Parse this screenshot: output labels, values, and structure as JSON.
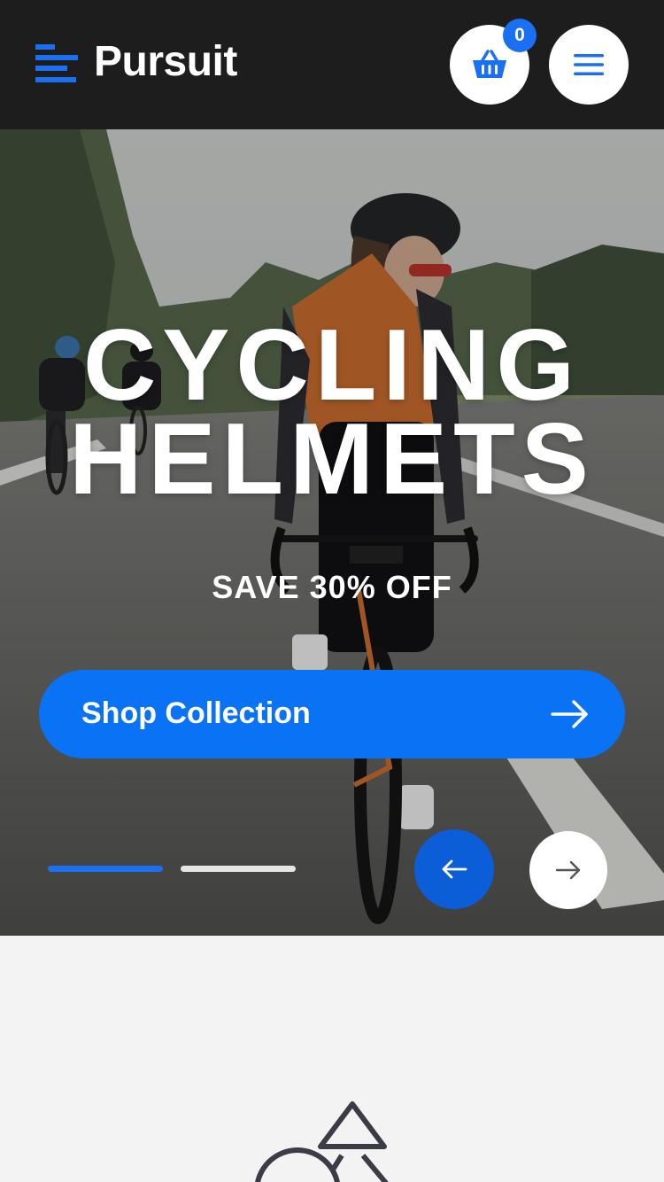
{
  "header": {
    "brand": "Pursuit",
    "cart_count": "0",
    "colors": {
      "background": "#1d1d1d",
      "accent": "#1a6ff2"
    }
  },
  "hero": {
    "title_line1": "CYCLING",
    "title_line2": "HELMETS",
    "subtitle": "SAVE 30% OFF",
    "cta_label": "Shop Collection",
    "cta_color": "#0a72f5",
    "slides": {
      "count": 2,
      "active": 1
    }
  },
  "icons": {
    "logo": "logo-bars-icon",
    "cart": "basket-icon",
    "menu": "hamburger-icon",
    "cta": "arrow-right-icon",
    "prev": "arrow-left-icon",
    "next": "arrow-right-icon",
    "section": "shapes-icon"
  }
}
